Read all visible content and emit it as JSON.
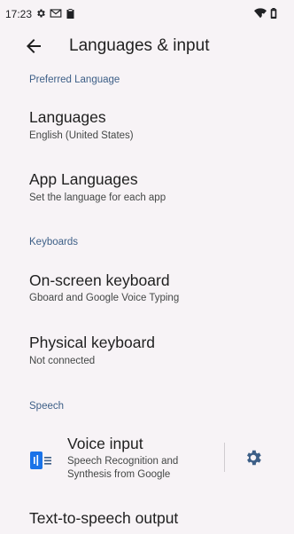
{
  "status_bar": {
    "time": "17:23"
  },
  "app_bar": {
    "title": "Languages & input"
  },
  "sections": {
    "preferred_language": "Preferred Language",
    "keyboards": "Keyboards",
    "speech": "Speech"
  },
  "items": {
    "languages": {
      "title": "Languages",
      "summary": "English (United States)"
    },
    "app_languages": {
      "title": "App Languages",
      "summary": "Set the language for each app"
    },
    "on_screen_keyboard": {
      "title": "On-screen keyboard",
      "summary": "Gboard and Google Voice Typing"
    },
    "physical_keyboard": {
      "title": "Physical keyboard",
      "summary": "Not connected"
    },
    "voice_input": {
      "title": "Voice input",
      "summary_line1": "Speech Recognition and",
      "summary_line2": "Synthesis from Google"
    },
    "tts_output": {
      "title": "Text-to-speech output"
    }
  },
  "icons": {
    "back": "arrow-back-icon",
    "settings": "gear-icon",
    "voice": "voice-input-icon",
    "status": [
      "settings-gear-icon",
      "gmail-icon",
      "clipboard-icon",
      "wifi-icon",
      "battery-icon"
    ]
  },
  "colors": {
    "background": "#f7f3f6",
    "section_header": "#3d5f87",
    "accent": "#1a73e8",
    "gear": "#3d5f87"
  }
}
